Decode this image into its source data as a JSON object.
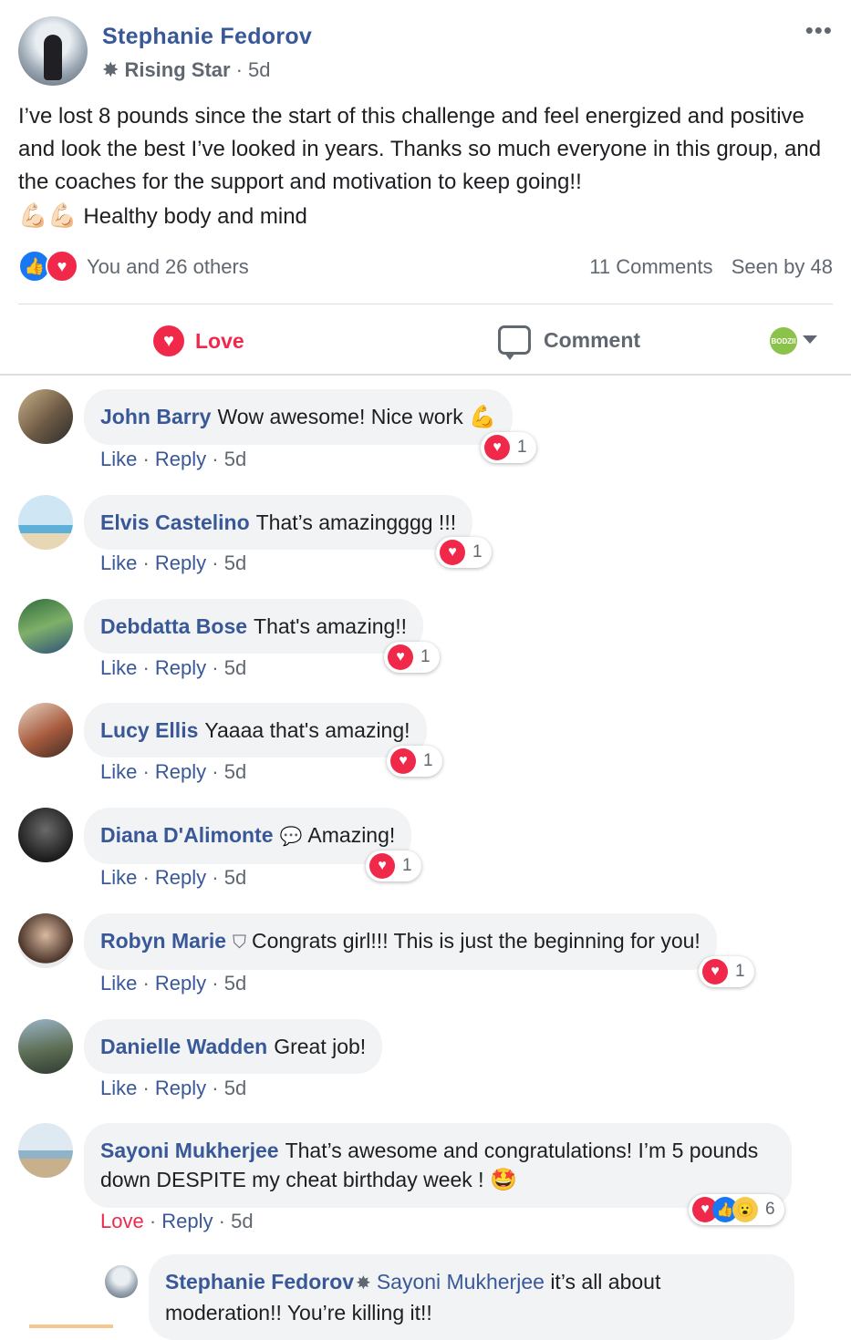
{
  "post": {
    "author": "Stephanie Fedorov",
    "badge": "Rising Star",
    "time": "· 5d",
    "more": "•••",
    "text_line1": "I’ve lost 8 pounds since the start of this challenge and feel energized and positive and look the best I’ve looked in years. Thanks so much everyone in this group, and the coaches for the support and motivation to keep going!!",
    "text_emoji": "💪🏻💪🏻",
    "text_line2": "Healthy body and mind",
    "reactions_summary": "You and 26 others",
    "comments_count": "11 Comments",
    "seen_by": "Seen by 48"
  },
  "actions": {
    "love_label": "Love",
    "comment_label": "Comment",
    "page_avatar": "BODZII"
  },
  "comments": [
    {
      "name": "John Barry",
      "text": "Wow awesome! Nice work",
      "emoji": "💪",
      "like": "Like",
      "reply": "Reply",
      "time": "5d",
      "react_count": "1"
    },
    {
      "name": "Elvis Castelino",
      "text": "That’s amazingggg !!!",
      "like": "Like",
      "reply": "Reply",
      "time": "5d",
      "react_count": "1"
    },
    {
      "name": "Debdatta Bose",
      "text": "That's amazing!!",
      "like": "Like",
      "reply": "Reply",
      "time": "5d",
      "react_count": "1"
    },
    {
      "name": "Lucy Ellis",
      "text": "Yaaaa that's amazing!",
      "like": "Like",
      "reply": "Reply",
      "time": "5d",
      "react_count": "1"
    },
    {
      "name": "Diana D'Alimonte",
      "text": "Amazing!",
      "like": "Like",
      "reply": "Reply",
      "time": "5d",
      "react_count": "1"
    },
    {
      "name": "Robyn Marie",
      "text": "Congrats girl!!! This is just the beginning for you!",
      "like": "Like",
      "reply": "Reply",
      "time": "5d",
      "react_count": "1"
    },
    {
      "name": "Danielle Wadden",
      "text": "Great job!",
      "like": "Like",
      "reply": "Reply",
      "time": "5d"
    },
    {
      "name": "Sayoni Mukherjee",
      "text": "That’s awesome and congratulations! I’m 5 pounds down DESPITE my cheat birthday week !",
      "emoji": "🤩",
      "like": "Love",
      "reply": "Reply",
      "time": "5d",
      "react_count": "6"
    }
  ],
  "reply": {
    "name": "Stephanie Fedorov",
    "mention": "Sayoni Mukherjee",
    "text": "it’s all about moderation!! You’re killing it!!"
  },
  "colors": {
    "link": "#385898",
    "love": "#f0284a",
    "like": "#1877f2",
    "muted": "#606770"
  }
}
